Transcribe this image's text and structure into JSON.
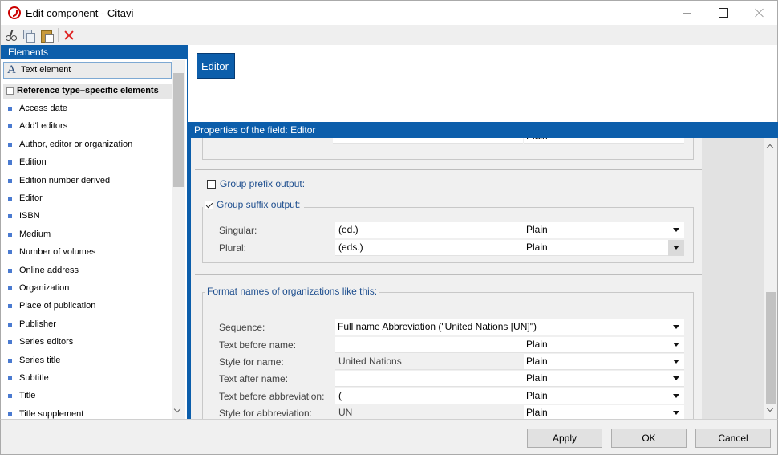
{
  "window": {
    "title": "Edit component - Citavi"
  },
  "left_panel": {
    "header": "Elements",
    "text_element": "Text element",
    "group_label": "Reference type–specific elements",
    "items": [
      "Access date",
      "Add'l editors",
      "Author, editor or organization",
      "Edition",
      "Edition number derived",
      "Editor",
      "ISBN",
      "Medium",
      "Number of volumes",
      "Online address",
      "Organization",
      "Place of publication",
      "Publisher",
      "Series editors",
      "Series title",
      "Subtitle",
      "Title",
      "Title supplement"
    ]
  },
  "editor": {
    "chip_label": "Editor"
  },
  "properties": {
    "header": "Properties of the field: Editor",
    "group_prefix": {
      "label": "Group prefix output:",
      "checked": false
    },
    "group_suffix": {
      "label": "Group suffix output:",
      "checked": true,
      "rows": [
        {
          "label": "Singular:",
          "value": "(ed.)",
          "style": "Plain"
        },
        {
          "label": "Plural:",
          "value": "(eds.)",
          "style": "Plain"
        }
      ]
    },
    "org_format": {
      "title": "Format names of organizations like this:",
      "sequence_label": "Sequence:",
      "sequence_value": "Full name Abbreviation (\"United Nations [UN]\")",
      "rows": [
        {
          "label": "Text before name:",
          "value": "",
          "style": "Plain"
        },
        {
          "label": "Style for name:",
          "value": "United Nations",
          "style": "Plain"
        },
        {
          "label": "Text after name:",
          "value": "",
          "style": "Plain"
        },
        {
          "label": "Text before abbreviation:",
          "value": "(",
          "style": "Plain"
        },
        {
          "label": "Style for abbreviation:",
          "value": "UN",
          "style": "Plain"
        }
      ]
    },
    "partial_row_style": "Plain"
  },
  "buttons": {
    "apply": "Apply",
    "ok": "OK",
    "cancel": "Cancel"
  }
}
